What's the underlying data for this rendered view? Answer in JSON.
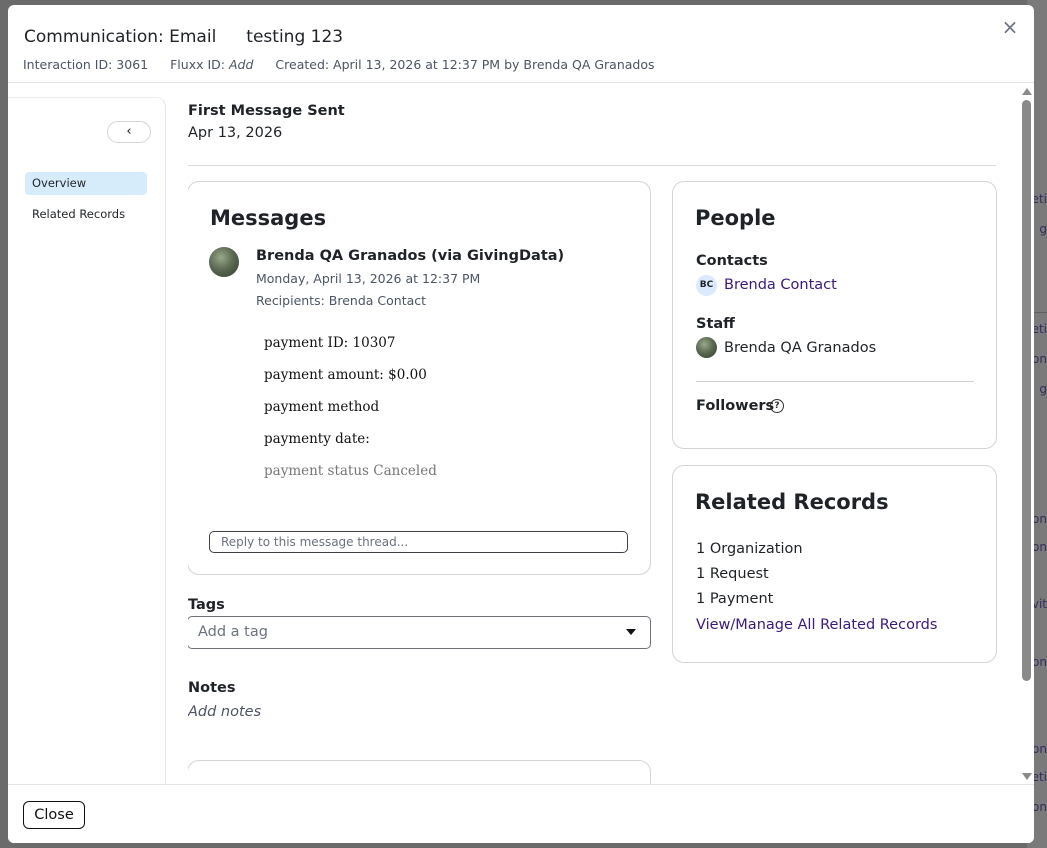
{
  "header": {
    "title": "Communication: Email",
    "subject": "testing 123",
    "interaction_id": "Interaction ID: 3061",
    "fluxx_id_label": "Fluxx ID:",
    "fluxx_id_value": "Add",
    "created": "Created: April 13, 2026 at 12:37 PM by Brenda QA Granados",
    "close_icon": "×"
  },
  "sidebar": {
    "collapse_icon": "‹",
    "items": [
      {
        "label": "Overview",
        "active": true
      },
      {
        "label": "Related Records",
        "active": false
      }
    ]
  },
  "main": {
    "first_message_label": "First Message Sent",
    "first_message_date": "Apr 13, 2026",
    "messages": {
      "title": "Messages",
      "sender": "Brenda QA Granados (via GivingData)",
      "date": "Monday, April 13, 2026 at 12:37 PM",
      "recipients": "Recipients: Brenda Contact",
      "body_lines": [
        "payment ID: 10307",
        "payment amount: $0.00",
        "payment method",
        "paymenty date:",
        "payment status Canceled"
      ],
      "reply_placeholder": "Reply to this message thread..."
    },
    "tags": {
      "label": "Tags",
      "placeholder": "Add a tag"
    },
    "notes": {
      "label": "Notes",
      "placeholder": "Add notes"
    }
  },
  "people": {
    "title": "People",
    "contacts_label": "Contacts",
    "contact_initials": "BC",
    "contact_name": "Brenda Contact",
    "staff_label": "Staff",
    "staff_name": "Brenda QA Granados",
    "followers_label": "Followers",
    "help_icon": "?"
  },
  "related_records": {
    "title": "Related Records",
    "items": [
      "1 Organization",
      "1 Request",
      "1 Payment"
    ],
    "link": "View/Manage All Related Records"
  },
  "footer": {
    "close_label": "Close"
  },
  "background_page": {
    "fragments": [
      "eti",
      "g",
      "eti",
      "on",
      "g",
      "on",
      "on",
      "vit",
      "on",
      "on",
      "eti",
      "on"
    ]
  },
  "colors": {
    "link": "#3b1a7a",
    "active_nav": "#d7ecfb",
    "badge": "#dbeafe"
  }
}
